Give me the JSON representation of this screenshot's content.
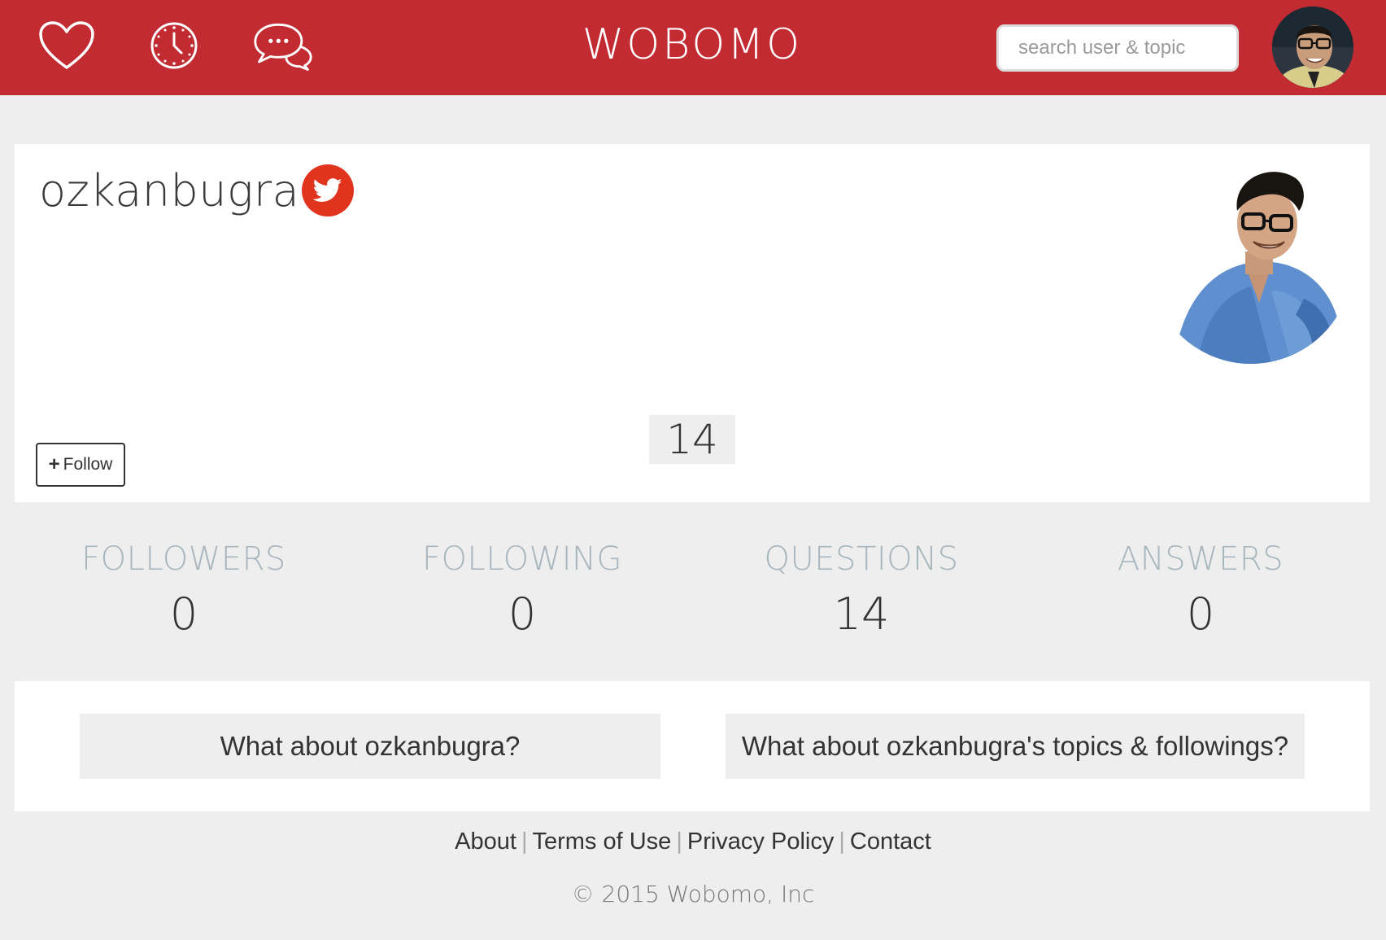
{
  "header": {
    "brand": "WOBOMO",
    "search_placeholder": "search user & topic",
    "icons": [
      "heart-icon",
      "clock-icon",
      "chat-bubbles-icon"
    ],
    "brand_color": "#c32b32"
  },
  "profile": {
    "username": "ozkanbugra",
    "social_icon": "twitter-icon",
    "count": "14",
    "follow_label": "Follow"
  },
  "stats": [
    {
      "label": "FOLLOWERS",
      "value": "0"
    },
    {
      "label": "FOLLOWING",
      "value": "0"
    },
    {
      "label": "QUESTIONS",
      "value": "14"
    },
    {
      "label": "ANSWERS",
      "value": "0"
    }
  ],
  "about": {
    "user_button": "What about ozkanbugra?",
    "topics_button": "What about ozkanbugra's topics & followings?"
  },
  "footer": {
    "links": [
      "About",
      "Terms of Use",
      "Privacy Policy",
      "Contact"
    ],
    "copyright": "© 2015 Wobomo, Inc"
  },
  "colors": {
    "header": "#c32b32",
    "twitter_badge": "#e1341e",
    "stat_label": "#a8b6bd",
    "background": "#eeeeee"
  }
}
